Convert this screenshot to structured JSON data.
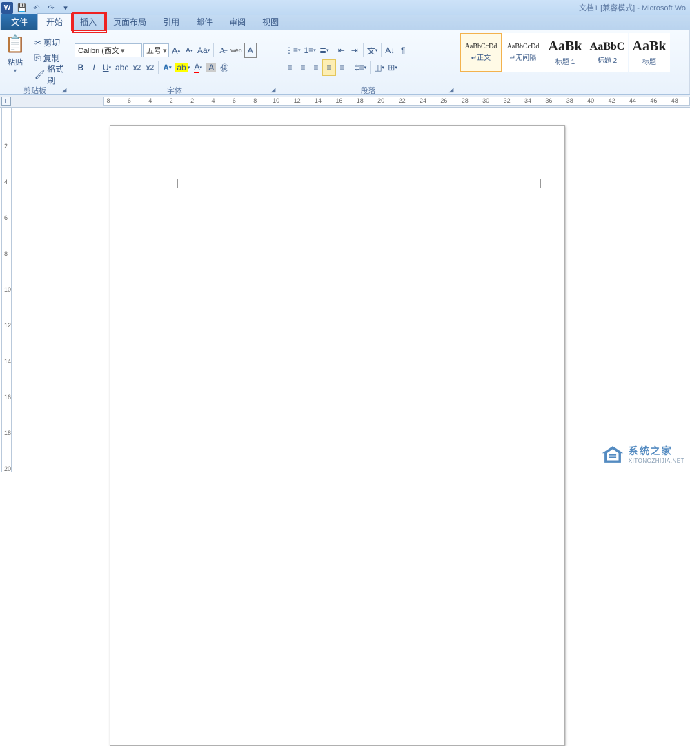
{
  "title": "文档1 [兼容模式] - Microsoft Wo",
  "app_icon_letter": "W",
  "qat": [
    "💾",
    "↶",
    "↷"
  ],
  "tabs": {
    "file": "文件",
    "list": [
      "开始",
      "插入",
      "页面布局",
      "引用",
      "邮件",
      "审阅",
      "视图"
    ],
    "active_index": 0,
    "highlight_index": 1
  },
  "clipboard": {
    "paste": "粘贴",
    "cut": "剪切",
    "copy": "复制",
    "fmtpaint": "格式刷",
    "label": "剪贴板"
  },
  "font": {
    "name": "Calibri (西文",
    "size": "五号",
    "label": "字体"
  },
  "para": {
    "label": "段落"
  },
  "styles": [
    {
      "preview": "AaBbCcDd",
      "name": "↵正文",
      "cls": "sm",
      "sel": true
    },
    {
      "preview": "AaBbCcDd",
      "name": "↵无间隔",
      "cls": "sm"
    },
    {
      "preview": "AaBk",
      "name": "标题 1",
      "cls": "lg"
    },
    {
      "preview": "AaBbC",
      "name": "标题 2",
      "cls": "lg"
    },
    {
      "preview": "AaBk",
      "name": "标题",
      "cls": "lg"
    }
  ],
  "ruler_h": [
    8,
    6,
    4,
    2,
    2,
    4,
    6,
    8,
    10,
    12,
    14,
    16,
    18,
    20,
    22,
    24,
    26,
    28,
    30,
    32,
    34,
    36,
    38,
    40,
    42,
    44,
    46,
    48
  ],
  "ruler_v": [
    2,
    4,
    6,
    8,
    10,
    12,
    14,
    16,
    18,
    20
  ],
  "watermark": {
    "cn": "系统之家",
    "en": "XITONGZHIJIA.NET"
  }
}
